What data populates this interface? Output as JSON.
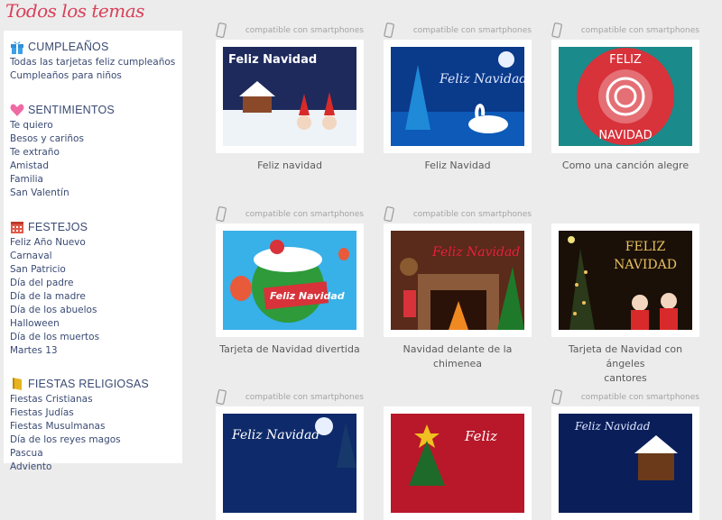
{
  "header": {
    "title": "Todos los temas"
  },
  "sidebar": {
    "sections": [
      {
        "title": "CUMPLEAÑOS",
        "icon": "gift-icon",
        "items": [
          "Todas las tarjetas feliz cumpleaños",
          "Cumpleaños para niños"
        ]
      },
      {
        "title": "SENTIMIENTOS",
        "icon": "heart-icon",
        "items": [
          "Te quiero",
          "Besos y cariños",
          "Te extraño",
          "Amistad",
          "Familia",
          "San Valentín"
        ]
      },
      {
        "title": "FESTEJOS",
        "icon": "calendar-icon",
        "items": [
          "Feliz Año Nuevo",
          "Carnaval",
          "San Patricio",
          "Día del padre",
          "Día de la madre",
          "Día de los abuelos",
          "Halloween",
          "Día de los muertos",
          "Martes 13"
        ]
      },
      {
        "title": "FIESTAS RELIGIOSAS",
        "icon": "book-icon",
        "items": [
          "Fiestas Cristianas",
          "Fiestas Judías",
          "Fiestas Musulmanas",
          "Día de los reyes magos",
          "Pascua",
          "Adviento"
        ]
      }
    ]
  },
  "compat_label": "compatible con smartphones",
  "cards": [
    {
      "caption": "Feliz navidad",
      "compat": true,
      "thumb_text": "Feliz Navidad"
    },
    {
      "caption": "Feliz Navidad",
      "compat": true,
      "thumb_text": "Feliz Navidad"
    },
    {
      "caption": "Como una canción alegre",
      "compat": true,
      "thumb_text_1": "FELIZ",
      "thumb_text_2": "NAVIDAD"
    },
    {
      "caption": "Tarjeta de Navidad divertida",
      "compat": true,
      "thumb_text": "Feliz Navidad"
    },
    {
      "caption": "Navidad delante de la chimenea",
      "compat": true,
      "thumb_text": "Feliz Navidad"
    },
    {
      "caption_line1": "Tarjeta de Navidad con ángeles",
      "caption_line2": "cantores",
      "compat": false,
      "thumb_text_1": "FELIZ",
      "thumb_text_2": "NAVIDAD"
    },
    {
      "compat": true,
      "thumb_text": "Feliz Navidad"
    },
    {
      "compat": false,
      "thumb_text": "Feliz"
    },
    {
      "compat": true,
      "thumb_text": "Feliz Navidad"
    }
  ],
  "colors": {
    "title": "#d8405a",
    "nav": "#3a4a73",
    "bg": "#ececec"
  }
}
